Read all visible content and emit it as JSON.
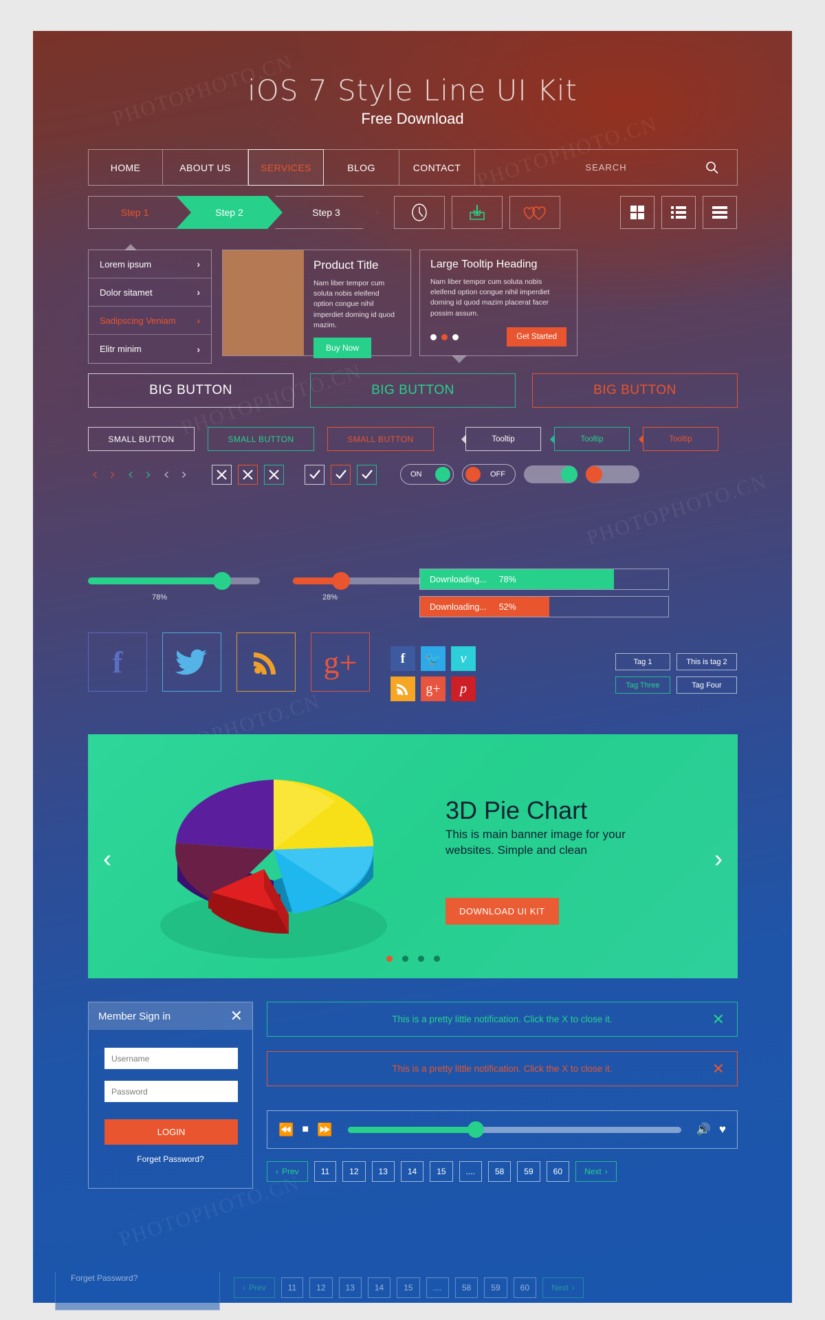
{
  "header": {
    "title": "iOS 7 Style Line UI Kit",
    "subtitle": "Free Download"
  },
  "nav": {
    "items": [
      {
        "label": "HOME",
        "active": false
      },
      {
        "label": "ABOUT US",
        "active": false
      },
      {
        "label": "SERVICES",
        "active": true
      },
      {
        "label": "BLOG",
        "active": false
      },
      {
        "label": "CONTACT",
        "active": false
      }
    ],
    "search_placeholder": "SEARCH",
    "search_icon": "search-icon"
  },
  "steps": [
    {
      "label": "Step 1",
      "state": "done"
    },
    {
      "label": "Step 2",
      "state": "active"
    },
    {
      "label": "Step 3",
      "state": "todo"
    }
  ],
  "icon_buttons": [
    {
      "name": "clock-icon"
    },
    {
      "name": "download-inbox-icon"
    },
    {
      "name": "hearts-icon"
    }
  ],
  "view_buttons": [
    {
      "name": "grid-view-icon"
    },
    {
      "name": "list-view-icon"
    },
    {
      "name": "menu-bars-icon"
    }
  ],
  "list_menu": {
    "items": [
      {
        "label": "Lorem ipsum",
        "active": false
      },
      {
        "label": "Dolor sitamet",
        "active": false
      },
      {
        "label": "Sadipscing Veniam",
        "active": true
      },
      {
        "label": "Elitr minim",
        "active": false
      }
    ]
  },
  "product_card": {
    "title": "Product Title",
    "body": "Nam liber tempor cum soluta nobis eleifend option congue nihil imperdiet doming id quod mazim.",
    "button": "Buy Now"
  },
  "tooltip_card": {
    "title": "Large Tooltip Heading",
    "body": "Nam liber tempor cum soluta nobis eleifend option congue nihil imperdiet doming id quod mazim placerat facer possim assum.",
    "button": "Get Started",
    "dots": 3,
    "active_dot": 1
  },
  "big_buttons": [
    {
      "label": "BIG BUTTON",
      "style": "white"
    },
    {
      "label": "BIG BUTTON",
      "style": "green"
    },
    {
      "label": "BIG BUTTON",
      "style": "orange"
    }
  ],
  "small_buttons": [
    {
      "label": "SMALL BUTTON",
      "style": "white"
    },
    {
      "label": "SMALL BUTTON",
      "style": "green"
    },
    {
      "label": "SMALL BUTTON",
      "style": "orange"
    }
  ],
  "tooltips": [
    {
      "label": "Tooltip",
      "style": "white"
    },
    {
      "label": "Tooltip",
      "style": "green"
    },
    {
      "label": "Tooltip",
      "style": "orange"
    }
  ],
  "toggles": [
    {
      "label": "ON",
      "state": "on"
    },
    {
      "label": "OFF",
      "state": "off"
    }
  ],
  "sliders": [
    {
      "value": "78%",
      "color": "#27d18c"
    },
    {
      "value": "28%",
      "color": "#e8552e"
    }
  ],
  "progress_bars": [
    {
      "label": "Downloading...",
      "value": "78%",
      "color": "#27d18c"
    },
    {
      "label": "Downloading...",
      "value": "52%",
      "color": "#e8552e"
    }
  ],
  "social_outline": [
    {
      "name": "facebook-icon",
      "glyph": "f",
      "color": "#5b6ec4"
    },
    {
      "name": "twitter-icon",
      "glyph": "t",
      "color": "#55b3e8"
    },
    {
      "name": "rss-icon",
      "glyph": "r",
      "color": "#f0a02a"
    },
    {
      "name": "googleplus-icon",
      "glyph": "g+",
      "color": "#e8553e"
    }
  ],
  "social_tiles": [
    {
      "name": "facebook-icon",
      "glyph": "f",
      "color": "#3d5a9e"
    },
    {
      "name": "twitter-icon",
      "glyph": "t",
      "color": "#2fa8e8"
    },
    {
      "name": "vimeo-icon",
      "glyph": "v",
      "color": "#2dcfd8"
    },
    {
      "name": "rss-icon",
      "glyph": "r",
      "color": "#f6a623"
    },
    {
      "name": "googleplus-icon",
      "glyph": "g+",
      "color": "#e8553e"
    },
    {
      "name": "pinterest-icon",
      "glyph": "p",
      "color": "#cc1f26"
    }
  ],
  "tags": [
    {
      "label": "Tag 1",
      "style": "white"
    },
    {
      "label": "This is tag 2",
      "style": "white"
    },
    {
      "label": "Tag Three",
      "style": "green"
    },
    {
      "label": "Tag Four",
      "style": "white"
    }
  ],
  "banner": {
    "title": "3D Pie Chart",
    "body": "This is main banner image for your websites. Simple and clean",
    "button": "DOWNLOAD UI KIT",
    "prev_icon": "chevron-left-icon",
    "next_icon": "chevron-right-icon",
    "dots": 4,
    "active_dot": 0
  },
  "chart_data": {
    "type": "pie",
    "title": "3D Pie Chart",
    "labels": [
      "Yellow",
      "Purple",
      "Red",
      "Blue",
      "Magenta"
    ],
    "values": [
      22,
      18,
      20,
      30,
      10
    ],
    "colors": [
      "#f7e017",
      "#5b1f9e",
      "#e02020",
      "#1eb8ee",
      "#b01b7a"
    ],
    "legend": "none"
  },
  "signin": {
    "heading": "Member Sign in",
    "close_icon": "close-icon",
    "username_placeholder": "Username",
    "password_placeholder": "Password",
    "login_label": "LOGIN",
    "forgot_label": "Forget Password?"
  },
  "notifications": [
    {
      "text": "This is a pretty little notification. Click the X to close it.",
      "style": "green"
    },
    {
      "text": "This is a pretty little notification. Click the X to close it.",
      "style": "orange"
    }
  ],
  "player": {
    "rewind_icon": "rewind-icon",
    "stop_icon": "stop-icon",
    "forward_icon": "fast-forward-icon",
    "volume_icon": "volume-icon",
    "heart_icon": "heart-icon",
    "progress": "38%"
  },
  "pagination": {
    "prev_label": "Prev",
    "next_label": "Next",
    "pages": [
      "11",
      "12",
      "13",
      "14",
      "15",
      "....",
      "58",
      "59",
      "60"
    ]
  },
  "watermark": "PHOTOPHOTO.CN"
}
